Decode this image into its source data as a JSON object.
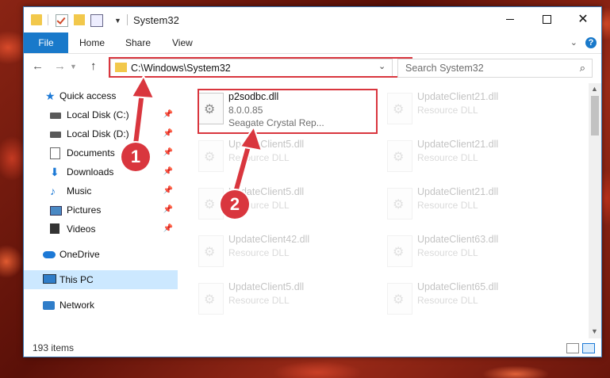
{
  "titlebar": {
    "title": "System32"
  },
  "ribbon": {
    "file": "File",
    "home": "Home",
    "share": "Share",
    "view": "View",
    "help": "?"
  },
  "address": {
    "path": "C:\\Windows\\System32",
    "search_placeholder": "Search System32"
  },
  "navpane": {
    "items": [
      {
        "label": "Quick access",
        "pinned": false
      },
      {
        "label": "Local Disk (C:)",
        "pinned": true
      },
      {
        "label": "Local Disk (D:)",
        "pinned": true
      },
      {
        "label": "Documents",
        "pinned": true
      },
      {
        "label": "Downloads",
        "pinned": true
      },
      {
        "label": "Music",
        "pinned": true
      },
      {
        "label": "Pictures",
        "pinned": true
      },
      {
        "label": "Videos",
        "pinned": true
      },
      {
        "label": "OneDrive",
        "pinned": false
      },
      {
        "label": "This PC",
        "pinned": false,
        "selected": true
      },
      {
        "label": "Network",
        "pinned": false
      }
    ]
  },
  "files": [
    {
      "name": "p2sodbc.dll",
      "line2": "8.0.0.85",
      "line3": "Seagate Crystal Rep..."
    },
    {
      "name": "UpdateClient21.dll",
      "line2": "Resource DLL"
    },
    {
      "name": "UpdateClient5.dll",
      "line2": "Resource DLL"
    },
    {
      "name": "UpdateClient21.dll",
      "line2": "Resource DLL"
    },
    {
      "name": "UpdateClient5.dll",
      "line2": "Resource DLL"
    },
    {
      "name": "UpdateClient21.dll",
      "line2": "Resource DLL"
    },
    {
      "name": "UpdateClient42.dll",
      "line2": "Resource DLL"
    },
    {
      "name": "UpdateClient63.dll",
      "line2": "Resource DLL"
    },
    {
      "name": "UpdateClient5.dll",
      "line2": "Resource DLL"
    },
    {
      "name": "UpdateClient65.dll",
      "line2": "Resource DLL"
    }
  ],
  "status": {
    "count": "193 items"
  },
  "callouts": {
    "one": "1",
    "two": "2"
  },
  "colors": {
    "accent": "#1979ca",
    "highlight": "#d9363e",
    "selected_nav": "#cce8ff"
  }
}
